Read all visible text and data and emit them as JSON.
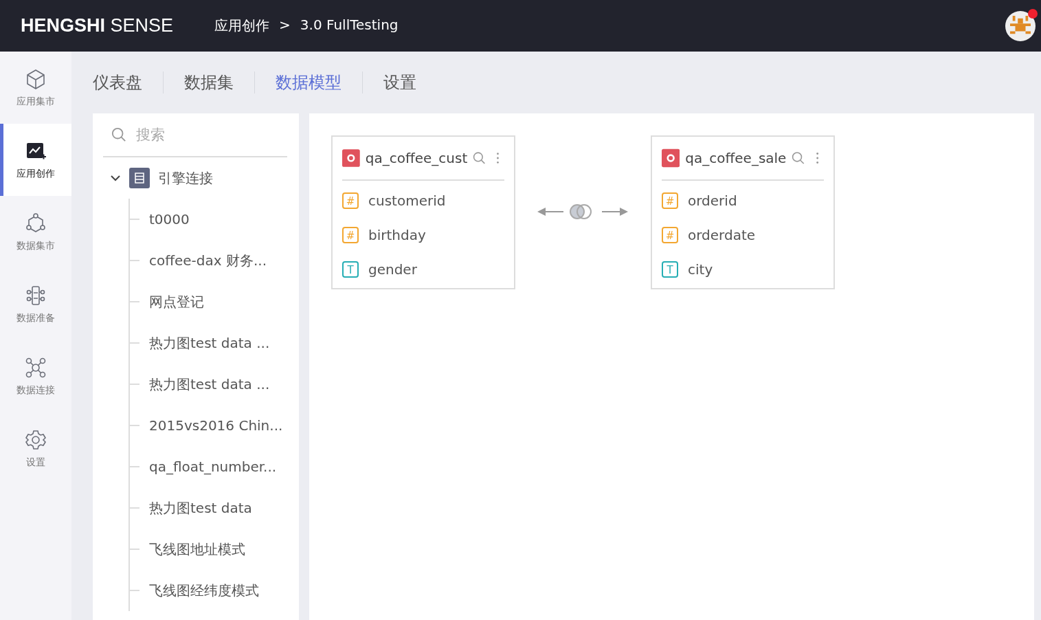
{
  "header": {
    "logo_bold": "HENGSHI",
    "logo_light": "SENSE",
    "breadcrumb": [
      {
        "label": "应用创作"
      },
      {
        "label": ">"
      },
      {
        "label": "3.0 FullTesting"
      }
    ],
    "avatar": {
      "notification": true
    }
  },
  "sidebar": {
    "items": [
      {
        "label": "应用集市",
        "selected": false
      },
      {
        "label": "应用创作",
        "selected": true
      },
      {
        "label": "数据集市",
        "selected": false
      },
      {
        "label": "数据准备",
        "selected": false
      },
      {
        "label": "数据连接",
        "selected": false
      },
      {
        "label": "设置",
        "selected": false
      }
    ]
  },
  "tabs": [
    {
      "label": "仪表盘",
      "selected": false
    },
    {
      "label": "数据集",
      "selected": false
    },
    {
      "label": "数据模型",
      "selected": true
    },
    {
      "label": "设置",
      "selected": false
    }
  ],
  "tree": {
    "search": {
      "placeholder": "搜索"
    },
    "root": {
      "label": "引擎连接",
      "expanded": true,
      "children": [
        {
          "label": "t0000"
        },
        {
          "label": "coffee-dax 财务..."
        },
        {
          "label": "网点登记"
        },
        {
          "label": "热力图test data ..."
        },
        {
          "label": "热力图test data ..."
        },
        {
          "label": "2015vs2016 Chin..."
        },
        {
          "label": "qa_float_number..."
        },
        {
          "label": "热力图test data"
        },
        {
          "label": "飞线图地址模式"
        },
        {
          "label": "飞线图经纬度模式"
        }
      ]
    }
  },
  "model": {
    "tables": [
      {
        "name": "qa_coffee_cust",
        "fields": [
          {
            "name": "customerid",
            "kind": "number",
            "type_mark": "#"
          },
          {
            "name": "birthday",
            "kind": "number",
            "type_mark": "#"
          },
          {
            "name": "gender",
            "kind": "text",
            "type_mark": "T"
          }
        ]
      },
      {
        "name": "qa_coffee_sale",
        "fields": [
          {
            "name": "orderid",
            "kind": "number",
            "type_mark": "#"
          },
          {
            "name": "orderdate",
            "kind": "number",
            "type_mark": "#"
          },
          {
            "name": "city",
            "kind": "text",
            "type_mark": "T"
          }
        ]
      }
    ]
  }
}
